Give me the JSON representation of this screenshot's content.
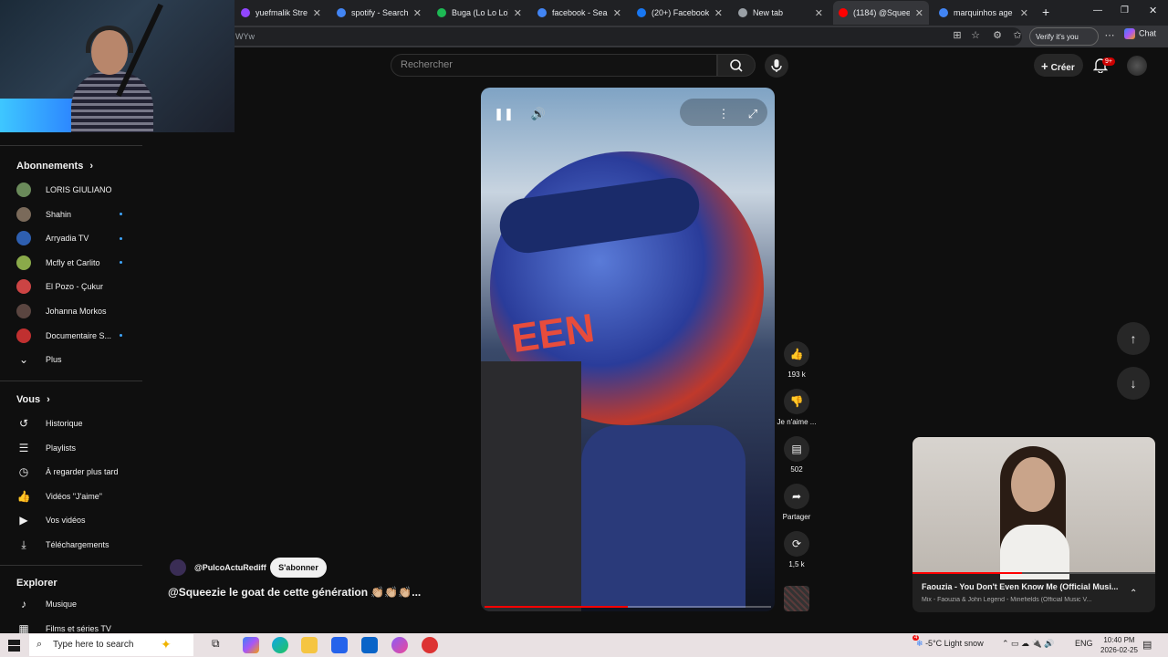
{
  "browser": {
    "tabs": [
      {
        "title": "yuefmalik Stream - Vi",
        "color": "#9146ff"
      },
      {
        "title": "spotify - Search",
        "color": "#4285f4"
      },
      {
        "title": "Buga (Lo Lo Lo) - so",
        "color": "#1db954"
      },
      {
        "title": "facebook - Search",
        "color": "#4285f4"
      },
      {
        "title": "(20+) Facebook",
        "color": "#1877f2"
      },
      {
        "title": "New tab",
        "color": "#9aa0a6"
      },
      {
        "title": "(1184) @Squee",
        "color": "#ff0000"
      },
      {
        "title": "marquinhos age - Se",
        "color": "#4285f4"
      }
    ],
    "url_fragment": "WYw",
    "verify_label": "Verify it's you",
    "chat_label": "Chat"
  },
  "header": {
    "search_placeholder": "Rechercher",
    "create_label": "Créer",
    "notif_badge": "9+"
  },
  "sidebar": {
    "subs_title": "Abonnements",
    "subscriptions": [
      {
        "name": "LORIS GIULIANO",
        "color": "#6a8a5a",
        "new": false
      },
      {
        "name": "Shahin",
        "color": "#7a6a5a",
        "new": true
      },
      {
        "name": "Arryadia TV",
        "color": "#2e5fb0",
        "new": true
      },
      {
        "name": "Mcfly et Carlito",
        "color": "#8aaa4a",
        "new": true
      },
      {
        "name": "El Pozo - Çukur",
        "color": "#c44",
        "new": false
      },
      {
        "name": "Johanna Morkos",
        "color": "#5a4540",
        "new": false
      },
      {
        "name": "Documentaire S...",
        "color": "#c03030",
        "new": true
      }
    ],
    "more_label": "Plus",
    "you_title": "Vous",
    "you_items": [
      {
        "label": "Historique",
        "icon": "history-icon"
      },
      {
        "label": "Playlists",
        "icon": "playlist-icon"
      },
      {
        "label": "À regarder plus tard",
        "icon": "clock-icon"
      },
      {
        "label": "Vidéos \"J'aime\"",
        "icon": "thumbs-up-icon"
      },
      {
        "label": "Vos vidéos",
        "icon": "play-square-icon"
      },
      {
        "label": "Téléchargements",
        "icon": "download-icon"
      }
    ],
    "explore_title": "Explorer",
    "explore_items": [
      {
        "label": "Musique",
        "icon": "music-icon"
      },
      {
        "label": "Films et séries TV",
        "icon": "film-icon"
      }
    ]
  },
  "short": {
    "channel": "@PulcoActuRediff",
    "subscribe_label": "S'abonner",
    "title": "@Squeezie le goat de cette génération 👏🏼👏🏼👏🏼...",
    "progress_fraction": 0.5,
    "likes": "193 k",
    "dislike_label": "Je n'aime ...",
    "comments": "502",
    "share_label": "Partager",
    "remix_count": "1,5 k"
  },
  "miniplayer": {
    "title": "Faouzia - You Don't Even Know Me (Official Musi...",
    "subtitle": "Mix - Faouzia & John Legend - Minefields (Official Music V...",
    "progress_fraction": 0.45
  },
  "taskbar": {
    "search_placeholder": "Type here to search",
    "weather": "-5°C  Light snow",
    "lang": "ENG",
    "time": "10:40 PM",
    "date": "2026-02-25",
    "notif_count": "4"
  }
}
